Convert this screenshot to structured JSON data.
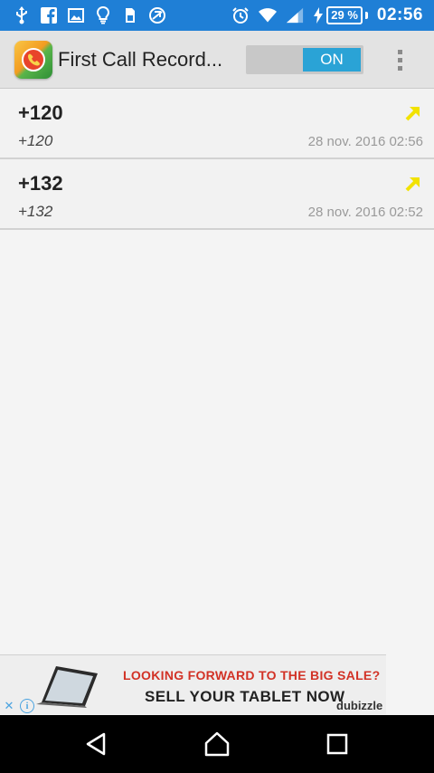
{
  "status_bar": {
    "battery": "29 %",
    "time": "02:56",
    "left_icons": [
      "usb-icon",
      "facebook-icon",
      "image-icon",
      "lightbulb-icon",
      "sim-icon",
      "screen-rotation-icon"
    ],
    "right_icons": [
      "alarm-icon",
      "wifi-icon",
      "signal-icon",
      "charging-icon"
    ]
  },
  "action_bar": {
    "app_icon": "first-call-recorder-app-icon",
    "title": "First Call Record...",
    "toggle_label": "ON",
    "menu_icon": "overflow-menu-icon"
  },
  "calls": [
    {
      "number": "+120",
      "name": "+120",
      "date": "28 nov. 2016  02:56",
      "direction_icon": "outgoing-call-arrow-icon"
    },
    {
      "number": "+132",
      "name": "+132",
      "date": "28 nov. 2016  02:52",
      "direction_icon": "outgoing-call-arrow-icon"
    }
  ],
  "ad": {
    "line1": "LOOKING FORWARD TO THE BIG SALE?",
    "line2": "SELL YOUR TABLET NOW",
    "brand": "dubizzle"
  },
  "nav_bar": {
    "icons": [
      "back-icon",
      "home-icon",
      "recents-icon"
    ]
  },
  "colors": {
    "status_bar": "#1f7fd6",
    "toggle_on": "#2aa3d6",
    "arrow": "#f2e200",
    "ad_headline": "#d23226"
  }
}
